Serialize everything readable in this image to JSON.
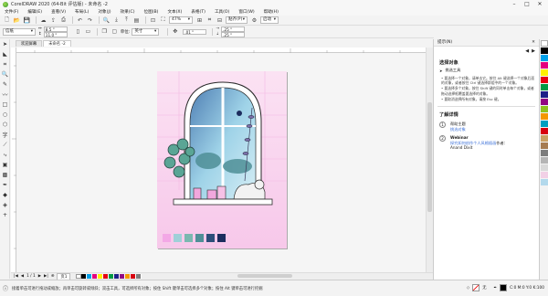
{
  "window": {
    "title": "CorelDRAW 2020 (64-Bit 评估版) - 未命名 -2",
    "minimize": "–",
    "maximize": "□",
    "close": "✕"
  },
  "menu": [
    "文件(F)",
    "编辑(E)",
    "查看(V)",
    "布局(L)",
    "对象(J)",
    "效果(C)",
    "位图(B)",
    "文本(X)",
    "表格(T)",
    "工具(O)",
    "窗口(W)",
    "帮助(H)"
  ],
  "toolbar": {
    "zoom": "47%",
    "snap_label": "贴齐(P)",
    "launch_label": "启动"
  },
  "propbar": {
    "page_size": "信纸",
    "width": "8.5 \"",
    "height": "11.0 \"",
    "units_label": "单位:",
    "units": "英寸",
    "nudge": ".01 \"",
    "dup_x": ".25 \"",
    "dup_y": ".25 \""
  },
  "doc_tabs": [
    {
      "label": "欢迎屏幕",
      "active": false
    },
    {
      "label": "未命名 -2",
      "active": true
    }
  ],
  "page_nav": {
    "counter": "1 / 1",
    "page_tab": "页1"
  },
  "status": {
    "message": "接着单击可进行拖动或缩放；再单击可旋转或倾斜；双击工具，可选择所有对象；按住 Shift 键单击可选择多个对象；按住 Alt 键单击可进行挖掘",
    "fill_label": "无",
    "color_readout": "C:0 M:0 Y:0 K:100"
  },
  "panel": {
    "header": "提示(N)",
    "section_title": "选择对象",
    "sub_title": "挑选工具",
    "bullets": [
      "要选择一个对象，请单击它。按住 Alt 键选择一个对象后面的对象，或者按住 Ctrl 键选择群组中的一个对象。",
      "要选择多个对象，按住 Shift 键的同时单击每个对象，或者拖动选择框覆盖要选择的对象。",
      "要取消选择所有对象，请按 Esc 键。"
    ],
    "learn_title": "了解详情",
    "items": [
      {
        "num": "1",
        "title": "帮助主题",
        "link": "挑选对象"
      },
      {
        "num": "2",
        "title": "Webinar",
        "link": "探究如何创作个人风格插画",
        "tail": "作者：",
        "author": "Anand Dixit"
      }
    ]
  },
  "colors": {
    "accent": "#2f7ed8",
    "page_bg_pink": "#f7d4ee",
    "window_frame": "#ffffff",
    "glass_blue": "#7cb4d8",
    "plant_green": "#3e8a7c"
  },
  "artwork_swatches": [
    "#f3a8e6",
    "#9fd0d8",
    "#7ab8b0",
    "#4f8f97",
    "#2d4e7a",
    "#1c2d5e"
  ],
  "palette_colors": [
    "#ffffff",
    "#000000",
    "#00a0e9",
    "#e4007f",
    "#fff100",
    "#e60012",
    "#009944",
    "#1d2088",
    "#920783",
    "#8fc31f",
    "#f39800",
    "#00a0c1",
    "#d7000f",
    "#c9a063",
    "#a67c52",
    "#7d7d7d",
    "#b5b5b5",
    "#d9d9d9",
    "#f2d0e6",
    "#b3d9ec"
  ],
  "bottom_palette": [
    "#ffffff",
    "#000000",
    "#00a0e9",
    "#e4007f",
    "#fff100",
    "#e60012",
    "#009944",
    "#1d2088",
    "#920783",
    "#f39800",
    "#d7000f",
    "#7d7d7d"
  ]
}
